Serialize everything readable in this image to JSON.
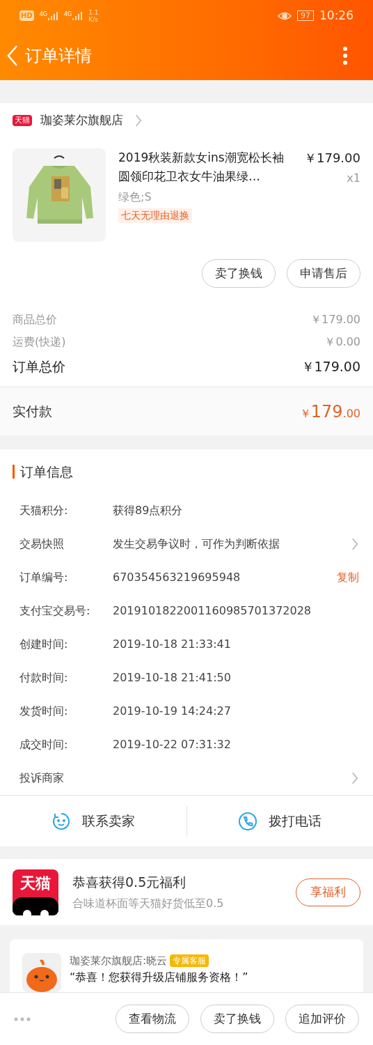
{
  "status_bar": {
    "hd": "HD",
    "network_speed": "1.1\nK/s",
    "signal_labels": [
      "4G",
      "4G"
    ],
    "battery": "97",
    "time": "10:26"
  },
  "header": {
    "title": "订单详情"
  },
  "store": {
    "badge": "天猫",
    "name": "珈姿莱尔旗舰店"
  },
  "product": {
    "title": "2019秋装新款女ins潮宽松长袖圆领印花卫衣女牛油果绿…",
    "price": "￥179.00",
    "quantity": "x1",
    "sku": "绿色;S",
    "tag": "七天无理由退换",
    "buttons": [
      "卖了换钱",
      "申请售后"
    ]
  },
  "totals": [
    {
      "label": "商品总价",
      "value": "￥179.00",
      "kind": "minor"
    },
    {
      "label": "运费(快递)",
      "value": "￥0.00",
      "kind": "minor"
    },
    {
      "label": "订单总价",
      "value": "￥179.00",
      "kind": "major"
    }
  ],
  "paid": {
    "label": "实付款",
    "currency": "￥",
    "integer": "179",
    "decimal": ".00"
  },
  "order_info": {
    "title": "订单信息",
    "rows": [
      {
        "label": "天猫积分:",
        "value": "获得89点积分",
        "arrow": false
      },
      {
        "label": "交易快照",
        "value": "发生交易争议时，可作为判断依据",
        "arrow": true
      },
      {
        "label": "订单编号:",
        "value": "670354563219695948",
        "action": "复制",
        "arrow": false
      },
      {
        "label": "支付宝交易号:",
        "value": "2019101822001160985701372028",
        "arrow": false
      },
      {
        "label": "创建时间:",
        "value": "2019-10-18 21:33:41",
        "arrow": false
      },
      {
        "label": "付款时间:",
        "value": "2019-10-18 21:41:50",
        "arrow": false
      },
      {
        "label": "发货时间:",
        "value": "2019-10-19 14:24:27",
        "arrow": false
      },
      {
        "label": "成交时间:",
        "value": "2019-10-22 07:31:32",
        "arrow": false
      },
      {
        "label": "投诉商家",
        "arrow": true
      }
    ]
  },
  "contact": [
    {
      "label": "联系卖家",
      "kind": "chat"
    },
    {
      "label": "拨打电话",
      "kind": "phone"
    }
  ],
  "promo": {
    "logo": "天猫",
    "title": "恭喜获得0.5元福利",
    "subtitle": "合味道杯面等天猫好货低至0.5",
    "button": "享福利"
  },
  "service_message": {
    "sender": "珈姿莱尔旗舰店:晓云",
    "badge": "专属客服",
    "text": "“恭喜！您获得升级店铺服务资格！”"
  },
  "bottom_bar": {
    "buttons": [
      "查看物流",
      "卖了换钱",
      "追加评价"
    ]
  }
}
